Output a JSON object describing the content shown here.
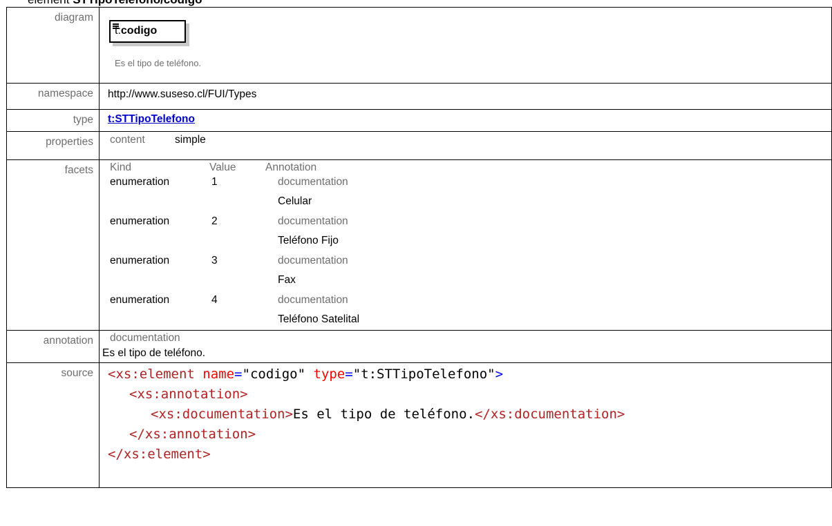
{
  "heading": {
    "prefix": "element",
    "name": "STTipoTelefono/codigo"
  },
  "diagram": {
    "label": "diagram",
    "element_prefix": "t:",
    "element_name": "codigo",
    "doc": "Es el tipo de teléfono."
  },
  "namespace": {
    "label": "namespace",
    "value": "http://www.suseso.cl/FUI/Types"
  },
  "type": {
    "label": "type",
    "value": "t:STTipoTelefono"
  },
  "properties": {
    "label": "properties",
    "key": "content",
    "value": "simple"
  },
  "facets": {
    "label": "facets",
    "headers": {
      "kind": "Kind",
      "value": "Value",
      "annotation": "Annotation"
    },
    "rows": [
      {
        "kind": "enumeration",
        "value": "1",
        "doc_label": "documentation",
        "doc": "Celular"
      },
      {
        "kind": "enumeration",
        "value": "2",
        "doc_label": "documentation",
        "doc": "Teléfono Fijo"
      },
      {
        "kind": "enumeration",
        "value": "3",
        "doc_label": "documentation",
        "doc": "Fax"
      },
      {
        "kind": "enumeration",
        "value": "4",
        "doc_label": "documentation",
        "doc": "Teléfono Satelital"
      }
    ]
  },
  "annotation": {
    "label": "annotation",
    "doc_label": "documentation",
    "doc": "Es el tipo de teléfono."
  },
  "source": {
    "label": "source",
    "line1": {
      "open": "<xs:element ",
      "attr1": "name",
      "eq1": "=",
      "val1": "\"codigo\"",
      "sp": " ",
      "attr2": "type",
      "eq2": "=",
      "val2": "\"t:STTipoTelefono\"",
      "close": ">"
    },
    "line2": "<xs:annotation>",
    "line3": {
      "open": "<xs:documentation>",
      "text": "Es el tipo de teléfono.",
      "close": "</xs:documentation>"
    },
    "line4": "</xs:annotation>",
    "line5": "</xs:element>"
  }
}
